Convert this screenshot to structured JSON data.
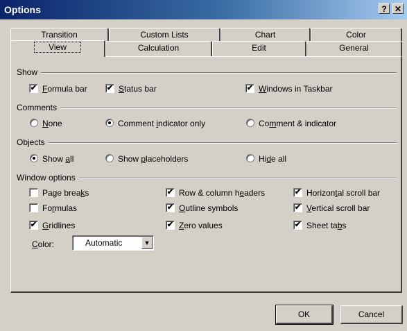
{
  "window": {
    "title": "Options",
    "help_button": "?",
    "close_button": "✕"
  },
  "tabs": {
    "back_row": [
      "Transition",
      "Custom Lists",
      "Chart",
      "Color"
    ],
    "front_row": [
      "View",
      "Calculation",
      "Edit",
      "General"
    ],
    "active": "View"
  },
  "show": {
    "label": "Show",
    "formula_bar": {
      "pre": "",
      "key": "F",
      "post": "ormula bar",
      "checked": true
    },
    "status_bar": {
      "pre": "",
      "key": "S",
      "post": "tatus bar",
      "checked": true
    },
    "windows_in_taskbar": {
      "pre": "",
      "key": "W",
      "post": "indows in Taskbar",
      "checked": true
    }
  },
  "comments": {
    "label": "Comments",
    "none": {
      "pre": "",
      "key": "N",
      "post": "one",
      "selected": false
    },
    "indicator_only": {
      "pre": "Comment ",
      "key": "i",
      "post": "ndicator only",
      "selected": true
    },
    "comment_and_indicator": {
      "pre": "Co",
      "key": "m",
      "post": "ment & indicator",
      "selected": false
    }
  },
  "objects": {
    "label": "Objects",
    "show_all": {
      "pre": "Show ",
      "key": "a",
      "post": "ll",
      "selected": true
    },
    "show_placeholders": {
      "pre": "Show ",
      "key": "p",
      "post": "laceholders",
      "selected": false
    },
    "hide_all": {
      "pre": "Hi",
      "key": "d",
      "post": "e all",
      "selected": false
    }
  },
  "window_options": {
    "label": "Window options",
    "page_breaks": {
      "pre": "Page brea",
      "key": "k",
      "post": "s",
      "checked": false
    },
    "formulas": {
      "pre": "Fo",
      "key": "r",
      "post": "mulas",
      "checked": false
    },
    "gridlines": {
      "pre": "",
      "key": "G",
      "post": "ridlines",
      "checked": true
    },
    "row_column_headers": {
      "pre": "Row & column h",
      "key": "e",
      "post": "aders",
      "checked": true
    },
    "outline_symbols": {
      "pre": "",
      "key": "O",
      "post": "utline symbols",
      "checked": true
    },
    "zero_values": {
      "pre": "",
      "key": "Z",
      "post": "ero values",
      "checked": true
    },
    "horizontal_scroll_bar": {
      "pre": "Horizon",
      "key": "t",
      "post": "al scroll bar",
      "checked": true
    },
    "vertical_scroll_bar": {
      "pre": "",
      "key": "V",
      "post": "ertical scroll bar",
      "checked": true
    },
    "sheet_tabs": {
      "pre": "Sheet ta",
      "key": "b",
      "post": "s",
      "checked": true
    },
    "color": {
      "pre": "",
      "key": "C",
      "post": "olor:",
      "value": "Automatic"
    }
  },
  "buttons": {
    "ok": "OK",
    "cancel": "Cancel"
  }
}
